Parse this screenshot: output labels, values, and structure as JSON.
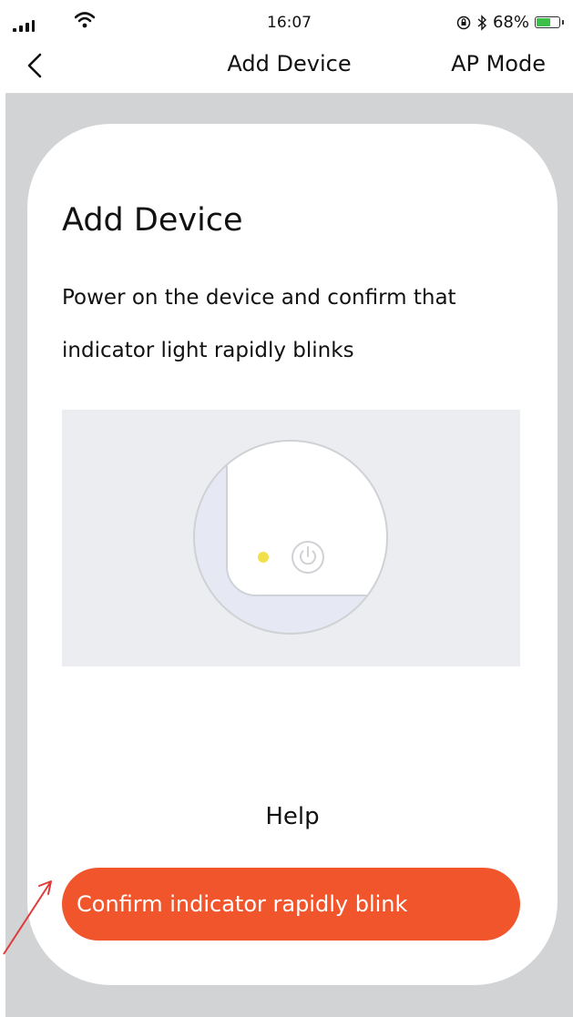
{
  "status_bar": {
    "time": "16:07",
    "battery_percent_label": "68%",
    "battery_level": 0.68,
    "battery_color": "#3cc04a"
  },
  "nav": {
    "title": "Add Device",
    "right_action": "AP Mode",
    "back_icon": "chevron-left-icon"
  },
  "card": {
    "title": "Add Device",
    "description": "Power on the device and confirm that indicator light rapidly blinks",
    "illustration_icons": [
      "indicator-light-icon",
      "power-icon"
    ],
    "indicator_color": "#f2e04a",
    "help_label": "Help",
    "confirm_label": "Confirm indicator rapidly blink",
    "accent_color": "#f1552c"
  },
  "annotation": {
    "arrow_color": "#e03a3a"
  }
}
